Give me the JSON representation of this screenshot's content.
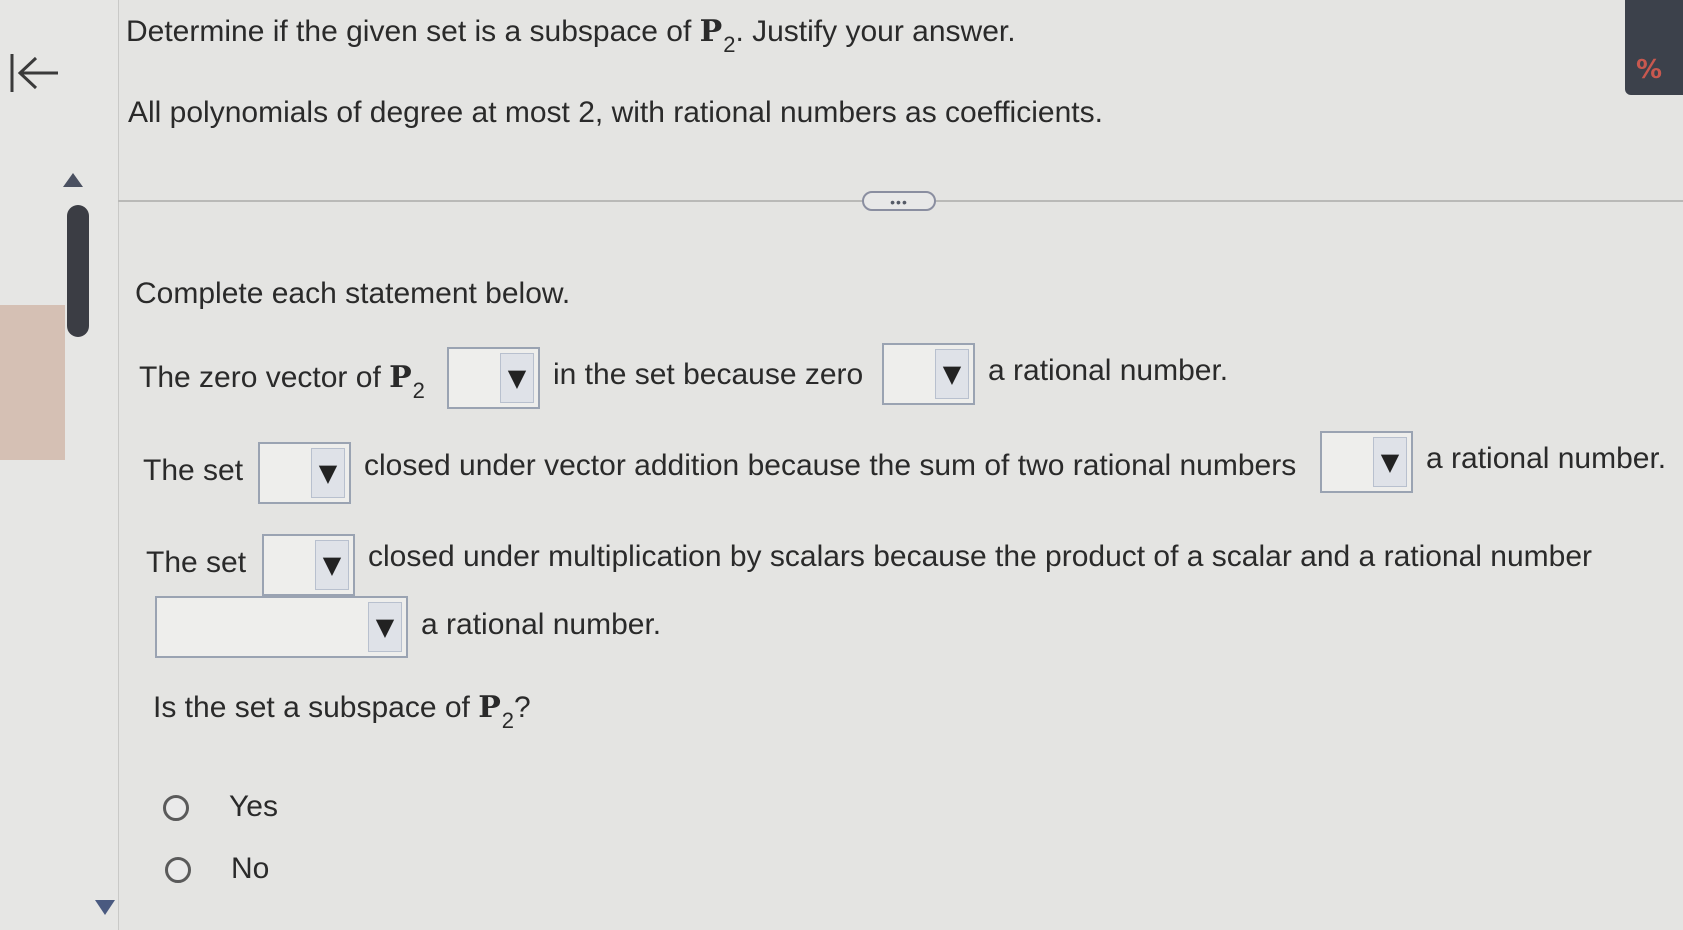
{
  "question": {
    "prompt_pre": "Determine if the given set is a subspace of ",
    "space_symbol": "P",
    "space_sub": "2",
    "prompt_post": ". Justify your answer.",
    "set_description": "All polynomials of degree at most 2, with rational numbers as coefficients."
  },
  "expand_button": {
    "label": "•••"
  },
  "instructions": "Complete each statement below.",
  "statement1": {
    "pre": "The zero vector of ",
    "space_symbol": "P",
    "space_sub": "2",
    "mid": "in the set because zero",
    "post": "a rational number."
  },
  "statement2": {
    "pre": "The set",
    "mid": "closed under vector addition because the sum of two rational numbers",
    "post": "a rational number."
  },
  "statement3": {
    "pre": "The set",
    "mid": "closed under multiplication by scalars because the product of a scalar and a rational number",
    "post": "a rational number."
  },
  "dropdowns": {
    "zero_in_set": "",
    "zero_is_rational": "",
    "closed_addition": "",
    "sum_is_rational": "",
    "closed_scalar": "",
    "product_is_rational": ""
  },
  "final_question": {
    "pre": "Is the set a subspace of ",
    "space_symbol": "P",
    "space_sub": "2",
    "post": "?",
    "options": [
      "Yes",
      "No"
    ]
  },
  "icons": {
    "back": "back-to-start-arrow-icon",
    "caret": "▼",
    "scroll_up": "triangle-up-icon",
    "scroll_down": "triangle-down-icon",
    "corner": "percent-icon"
  },
  "corner_glyph": "%",
  "colors": {
    "background": "#e4e4e2",
    "text": "#2a2a2a",
    "dropdown_border": "#9aa3b2",
    "scrollbar": "#3b3d44"
  }
}
